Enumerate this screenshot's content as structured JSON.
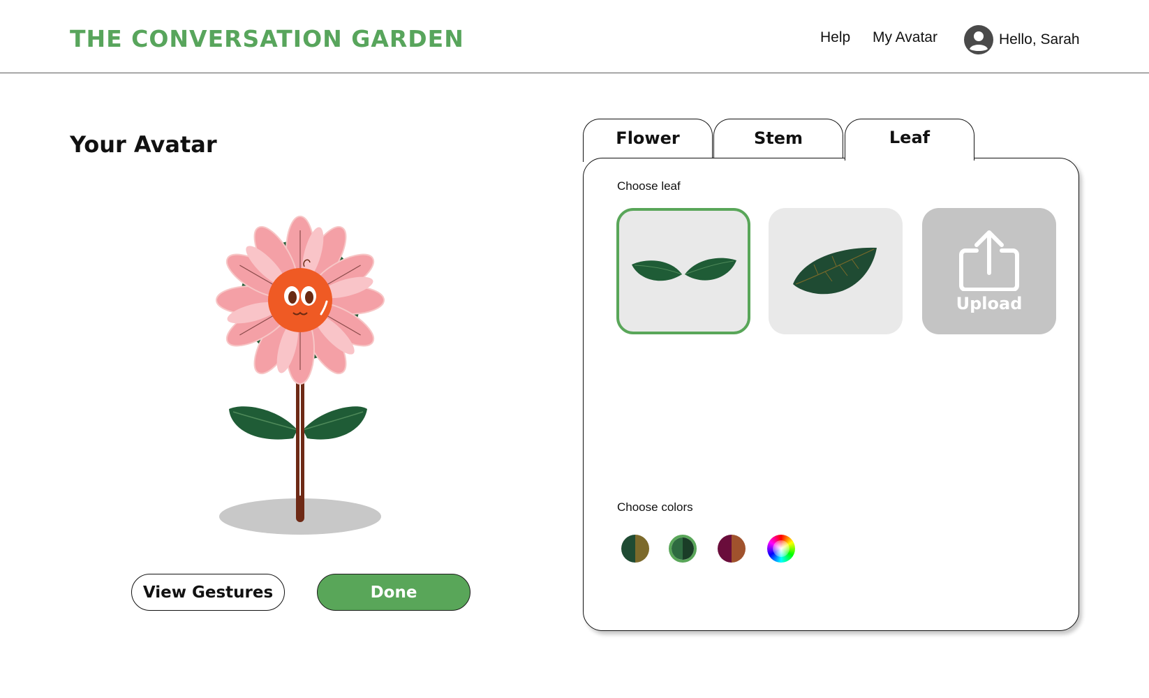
{
  "header": {
    "brand": "THE CONVERSATION GARDEN",
    "nav": {
      "help": "Help",
      "my_avatar": "My Avatar"
    },
    "user": {
      "greeting": "Hello, Sarah",
      "icon": "user-avatar-icon"
    }
  },
  "avatar_section": {
    "title": "Your Avatar",
    "view_gestures_label": "View Gestures",
    "done_label": "Done"
  },
  "editor": {
    "tabs": [
      {
        "label": "Flower",
        "active": false
      },
      {
        "label": "Stem",
        "active": false
      },
      {
        "label": "Leaf",
        "active": true
      }
    ],
    "choose_leaf_label": "Choose leaf",
    "leaf_options": [
      {
        "id": "double-leaf",
        "selected": true
      },
      {
        "id": "single-leaf",
        "selected": false
      },
      {
        "id": "upload",
        "label": "Upload",
        "icon": "upload-icon",
        "selected": false
      }
    ],
    "choose_colors_label": "Choose colors",
    "color_swatches": [
      {
        "colors": [
          "#1f4b33",
          "#7c6a2b"
        ],
        "selected": false
      },
      {
        "colors": [
          "#2e6b40",
          "#1a3d27"
        ],
        "selected": true
      },
      {
        "colors": [
          "#6a0d3b",
          "#a0522d"
        ],
        "selected": false
      },
      {
        "colors": [
          "rainbow"
        ],
        "selected": false,
        "icon": "color-wheel-icon"
      }
    ]
  },
  "colors": {
    "brand_green": "#58a55c",
    "leaf_green": "#1f5c36",
    "petal_pink": "#f2a0a4",
    "flower_center": "#ef5a24"
  }
}
